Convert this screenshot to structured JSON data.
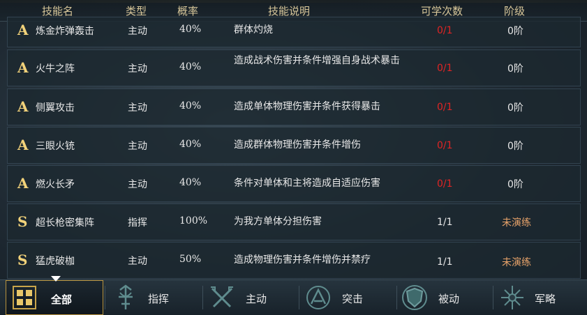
{
  "header": {
    "name": "技能名",
    "type": "类型",
    "rate": "概率",
    "desc": "技能说明",
    "count": "可学次数",
    "stage": "阶级"
  },
  "rows": [
    {
      "grade": "A",
      "name": "炼金炸弹轰击",
      "type": "主动",
      "rate": "40%",
      "desc": "群体灼烧",
      "count": "0/1",
      "stage": "0阶"
    },
    {
      "grade": "A",
      "name": "火牛之阵",
      "type": "主动",
      "rate": "40%",
      "desc": "造成战术伤害并条件增强自身战术暴击",
      "count": "0/1",
      "stage": "0阶"
    },
    {
      "grade": "A",
      "name": "侧翼攻击",
      "type": "主动",
      "rate": "40%",
      "desc": "造成单体物理伤害并条件获得暴击",
      "count": "0/1",
      "stage": "0阶"
    },
    {
      "grade": "A",
      "name": "三眼火铳",
      "type": "主动",
      "rate": "40%",
      "desc": "造成群体物理伤害并条件增伤",
      "count": "0/1",
      "stage": "0阶"
    },
    {
      "grade": "A",
      "name": "燃火长矛",
      "type": "主动",
      "rate": "40%",
      "desc": "条件对单体和主将造成自适应伤害",
      "count": "0/1",
      "stage": "0阶"
    },
    {
      "grade": "S",
      "name": "超长枪密集阵",
      "type": "指挥",
      "rate": "100%",
      "desc": "为我方单体分担伤害",
      "count": "1/1",
      "stage": "未演练"
    },
    {
      "grade": "S",
      "name": "猛虎破枷",
      "type": "主动",
      "rate": "50%",
      "desc": "造成物理伤害并条件增伤并禁疗",
      "count": "1/1",
      "stage": "未演练"
    }
  ],
  "tabs": [
    {
      "label": "全部",
      "icon": "grid-icon"
    },
    {
      "label": "指挥",
      "icon": "command-icon"
    },
    {
      "label": "主动",
      "icon": "crossed-swords-icon"
    },
    {
      "label": "突击",
      "icon": "assault-icon"
    },
    {
      "label": "被动",
      "icon": "shield-icon"
    },
    {
      "label": "军略",
      "icon": "strategy-icon"
    }
  ],
  "colors": {
    "gold": "#f2d27a",
    "red": "#e02424",
    "orange": "#e8a36a"
  }
}
